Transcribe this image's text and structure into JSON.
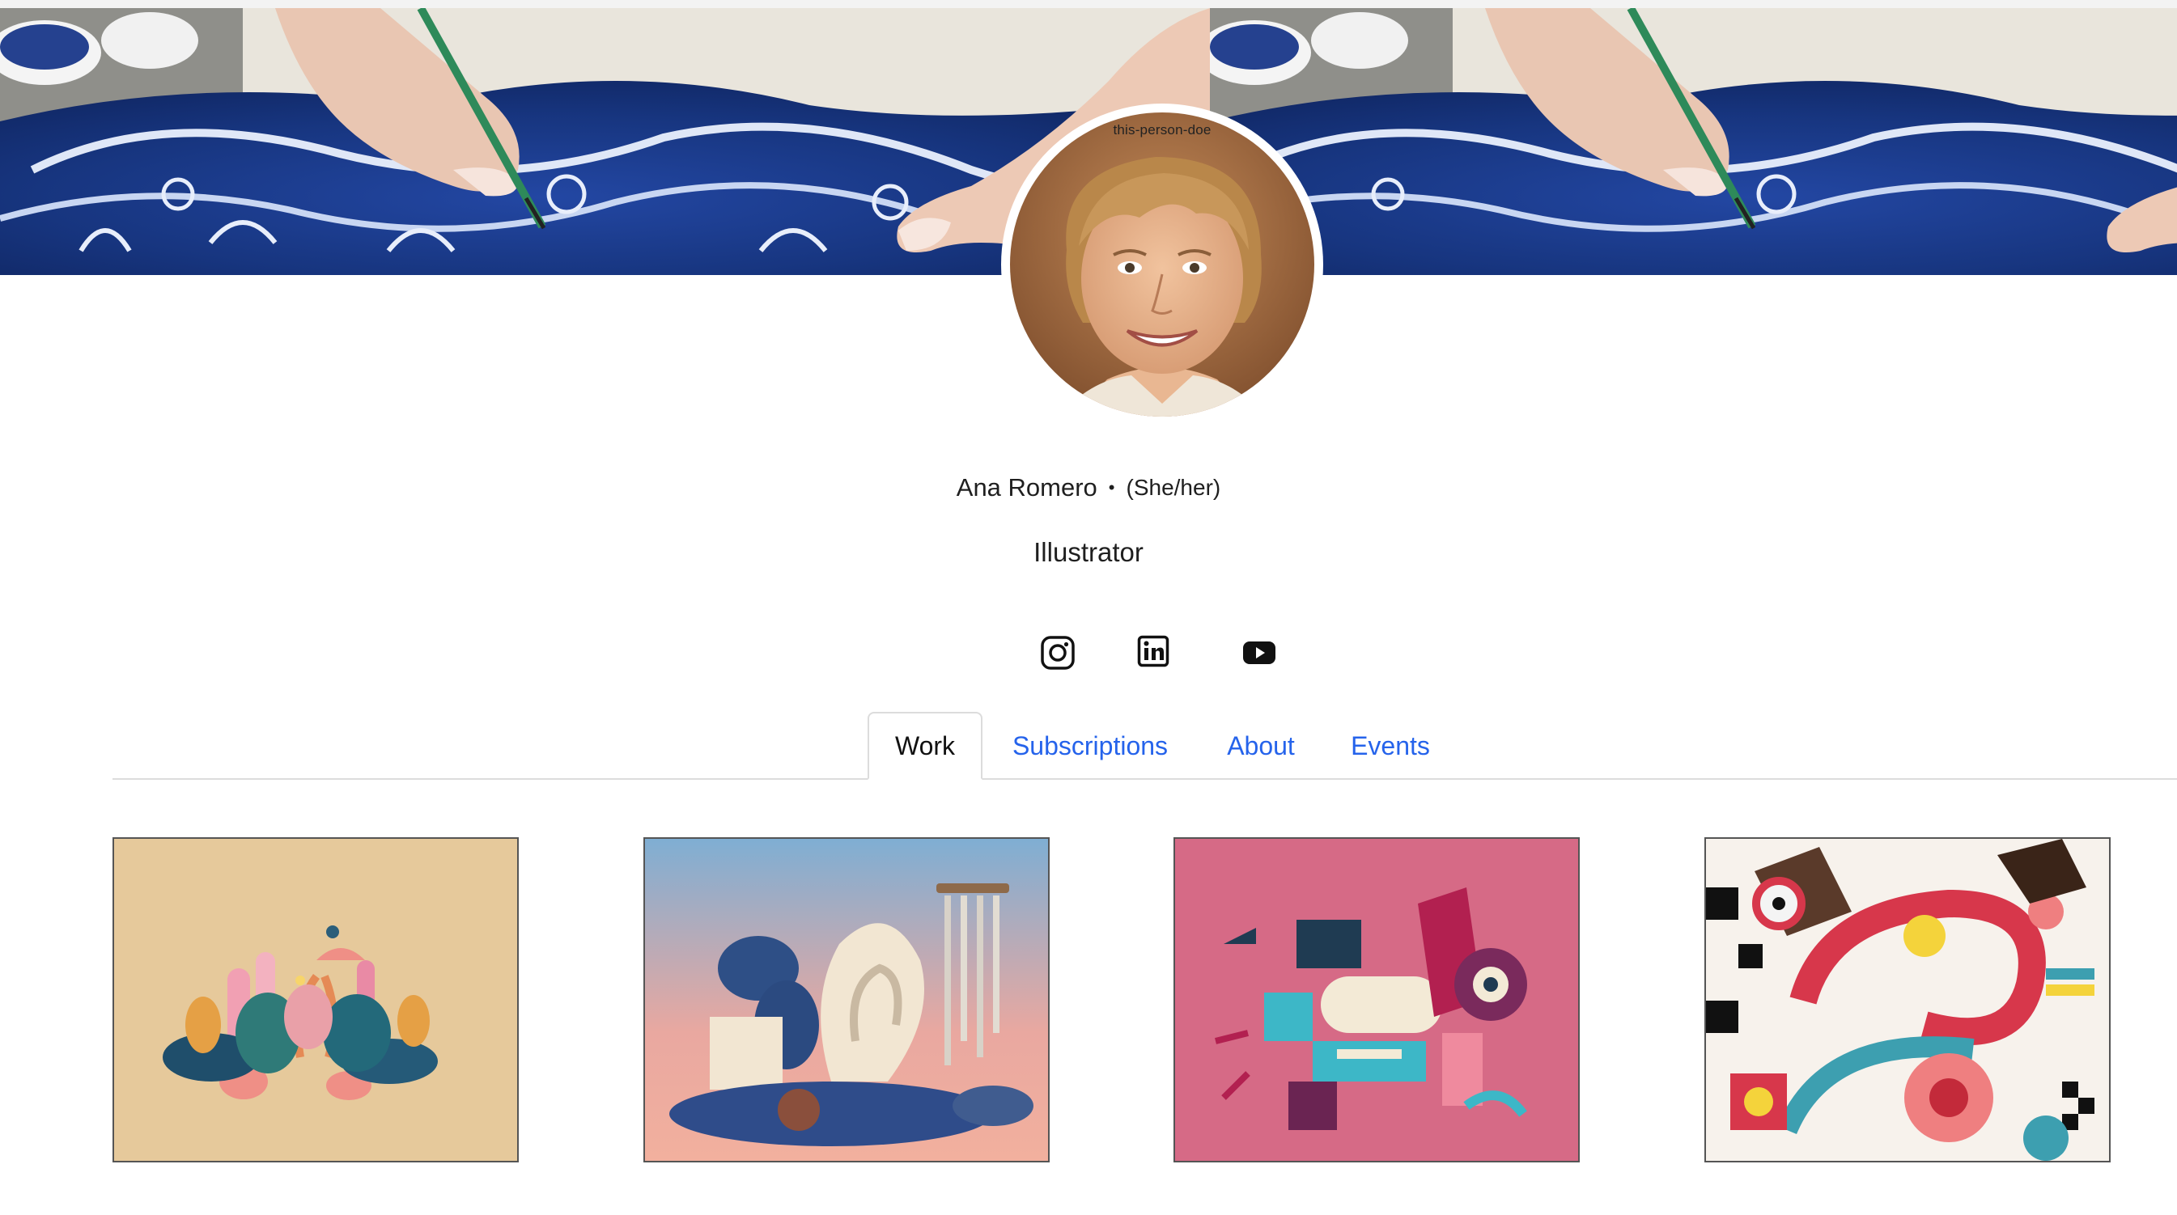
{
  "profile": {
    "name": "Ana Romero",
    "separator": "•",
    "pronouns": "(She/her)",
    "role": "Illustrator",
    "avatar_alt": "this-person-doe"
  },
  "social": [
    {
      "icon": "instagram-icon"
    },
    {
      "icon": "linkedin-icon"
    },
    {
      "icon": "youtube-icon"
    }
  ],
  "tabs": [
    {
      "label": "Work",
      "active": true
    },
    {
      "label": "Subscriptions",
      "active": false
    },
    {
      "label": "About",
      "active": false
    },
    {
      "label": "Events",
      "active": false
    }
  ],
  "colors": {
    "link": "#2563eb",
    "tab_border": "#dcdcdc",
    "text": "#1f1f1f"
  }
}
